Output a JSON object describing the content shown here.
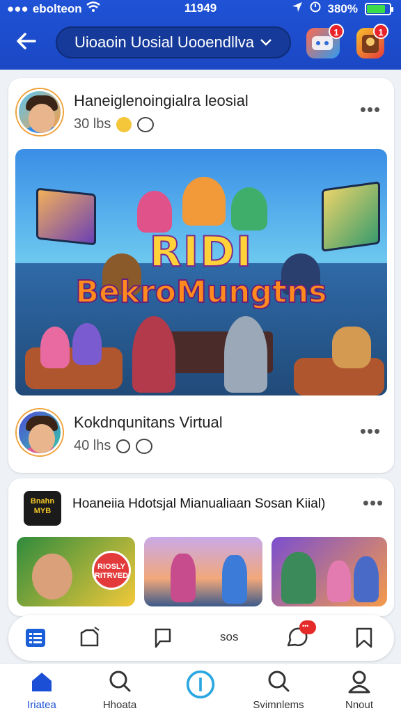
{
  "status_bar": {
    "carrier": "ebolteon",
    "time": "11949",
    "battery": "380%",
    "battery_level": 0.8
  },
  "header": {
    "title": "Uioaoin Uosial Uooendllva",
    "notification_badge_1": "1",
    "notification_badge_2": "1"
  },
  "post1": {
    "author": "Haneiglenoingialra leosial",
    "meta": "30 lbs",
    "image_headline_line1": "RIDI",
    "image_headline_line2": "BekroMungtns"
  },
  "post2": {
    "author": "Kokdnqunitans Virtual",
    "meta": "40 lhs"
  },
  "card2": {
    "logo_text": "Bnahn MYB",
    "title": "Hoaneiia Hdotsjal Mianualiaan Sosan Kiial)",
    "thumb1_label": "RIOSLY RITRVED"
  },
  "action_bar": {
    "text": "sos"
  },
  "bottom_nav": {
    "items": [
      {
        "label": "Iriatea"
      },
      {
        "label": "Hhoata"
      },
      {
        "label": ""
      },
      {
        "label": "Svimnlems"
      },
      {
        "label": "Nnout"
      }
    ]
  },
  "colors": {
    "header_blue": "#1f52d6",
    "accent_blue": "#1b4fd6",
    "badge_red": "#e8242a"
  }
}
